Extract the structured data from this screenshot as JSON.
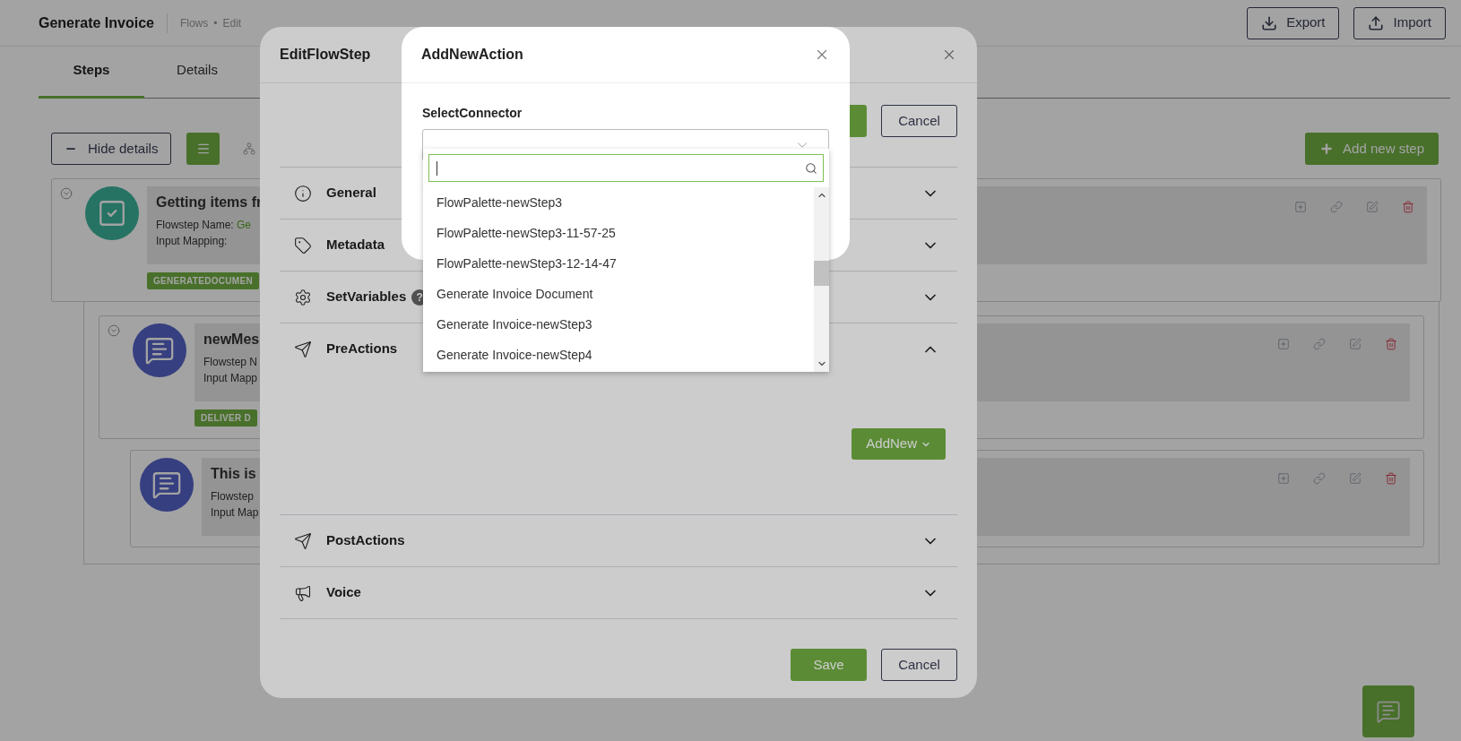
{
  "header": {
    "title": "Generate Invoice",
    "breadcrumb": [
      "Flows",
      "Edit"
    ],
    "separator": "•",
    "buttons": [
      {
        "kind": "export",
        "label": "Export"
      },
      {
        "kind": "import",
        "label": "Import"
      }
    ]
  },
  "tabs": [
    {
      "label": "Steps",
      "selected": true
    },
    {
      "label": "Details",
      "selected": false
    }
  ],
  "toolbar": {
    "hide_details": "Hide details",
    "list_view_selected": true,
    "add_step": "Add new step"
  },
  "steps": [
    {
      "kind": "task",
      "title": "Getting items fr",
      "name_label": "Flowstep Name:",
      "name_value": "Ge",
      "mapping_label": "Input Mapping:",
      "tag": "GENERATEDOCUMEN",
      "collapsible": true,
      "children": [
        {
          "kind": "message",
          "title": "newMes",
          "name_label": "Flowstep N",
          "mapping_label": "Input Mapp",
          "tag": "DELIVER D",
          "collapsible": true,
          "children": [
            {
              "kind": "message",
              "title": "This is",
              "name_label": "Flowstep",
              "mapping_label": "Input Map",
              "collapsible": false
            }
          ]
        }
      ]
    }
  ],
  "edit_modal": {
    "title": "EditFlowStep",
    "top_cancel": "Cancel",
    "sections": [
      {
        "kind": "info",
        "label": "General",
        "expanded": false
      },
      {
        "kind": "tag",
        "label": "Metadata",
        "expanded": false
      },
      {
        "kind": "gear",
        "label": "SetVariables",
        "help": "?",
        "expanded": false
      },
      {
        "kind": "plane",
        "label": "PreActions",
        "expanded": true,
        "add_button": "AddNew"
      },
      {
        "kind": "plane",
        "label": "PostActions",
        "expanded": false
      },
      {
        "kind": "megaphone",
        "label": "Voice",
        "expanded": false
      }
    ],
    "save": "Save",
    "cancel": "Cancel"
  },
  "action_modal": {
    "title": "AddNewAction",
    "field_label": "SelectConnector",
    "dropdown_open": true,
    "options": [
      "FlowPalette-newStep3",
      "FlowPalette-newStep3-11-57-25",
      "FlowPalette-newStep3-12-14-47",
      "Generate Invoice Document",
      "Generate Invoice-newStep3",
      "Generate Invoice-newStep4"
    ]
  }
}
